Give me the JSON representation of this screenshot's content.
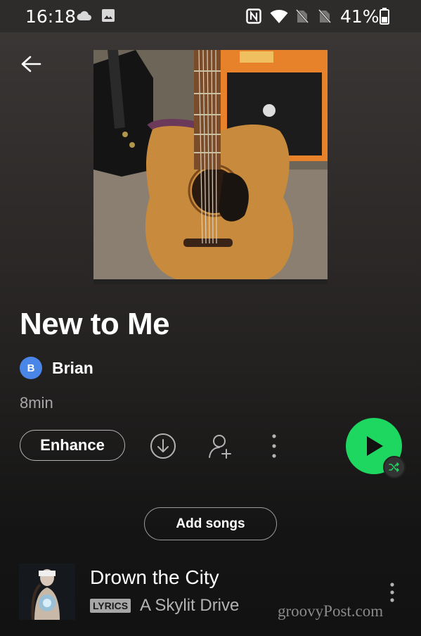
{
  "status_bar": {
    "time": "16:18",
    "battery_percent": "41%",
    "icons": [
      "cloud-icon",
      "image-icon",
      "nfc-icon",
      "wifi-icon",
      "no-sim-icon",
      "no-sim-icon",
      "battery-icon"
    ]
  },
  "header": {
    "back_icon": "back-arrow-icon"
  },
  "playlist": {
    "title": "New to Me",
    "owner_initial": "B",
    "owner_name": "Brian",
    "duration": "8min",
    "avatar_color": "#4a86e8"
  },
  "actions": {
    "enhance_label": "Enhance",
    "icons": [
      "download-icon",
      "add-user-icon",
      "more-vert-icon"
    ],
    "play_color": "#1ed760",
    "shuffle_icon": "shuffle-icon"
  },
  "add_songs_label": "Add songs",
  "tracks": [
    {
      "title": "Drown the City",
      "badge": "LYRICS",
      "artist": "A Skylit Drive"
    }
  ],
  "watermark": "groovyPost.com"
}
